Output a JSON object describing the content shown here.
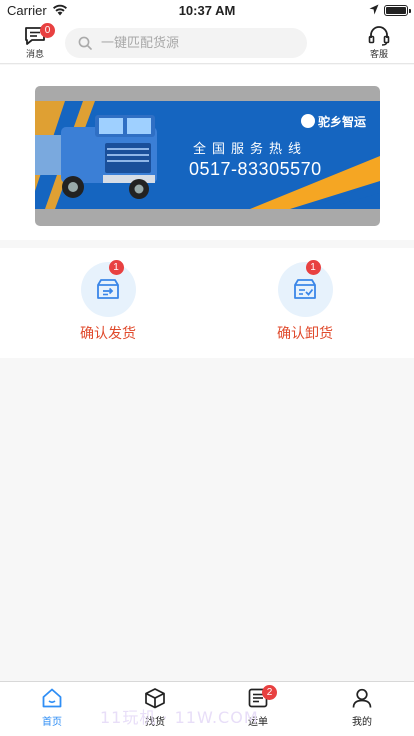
{
  "status_bar": {
    "carrier": "Carrier",
    "time": "10:37 AM"
  },
  "header": {
    "messages": {
      "label": "消息",
      "badge": "0"
    },
    "search": {
      "placeholder": "一键匹配货源"
    },
    "customer_service": {
      "label": "客服"
    }
  },
  "banner": {
    "logo_text": "驼乡智运",
    "service_line": "全国服务热线",
    "phone": "0517-83305570"
  },
  "actions": [
    {
      "label": "确认发货",
      "badge": "1",
      "icon": "ship-box-icon"
    },
    {
      "label": "确认卸货",
      "badge": "1",
      "icon": "unload-box-icon"
    }
  ],
  "tabbar": {
    "items": [
      {
        "label": "首页",
        "icon": "home-icon",
        "active": true
      },
      {
        "label": "找货",
        "icon": "box-icon",
        "active": false
      },
      {
        "label": "运单",
        "icon": "waybill-icon",
        "active": false,
        "badge": "2"
      },
      {
        "label": "我的",
        "icon": "user-icon",
        "active": false
      }
    ],
    "watermark": "11玩机 · 11W.COM"
  },
  "colors": {
    "accent": "#2f8ef5",
    "action_text": "#e04a2c",
    "badge": "#e84141",
    "banner_blue": "#1565c0",
    "banner_orange": "#f5a623"
  }
}
